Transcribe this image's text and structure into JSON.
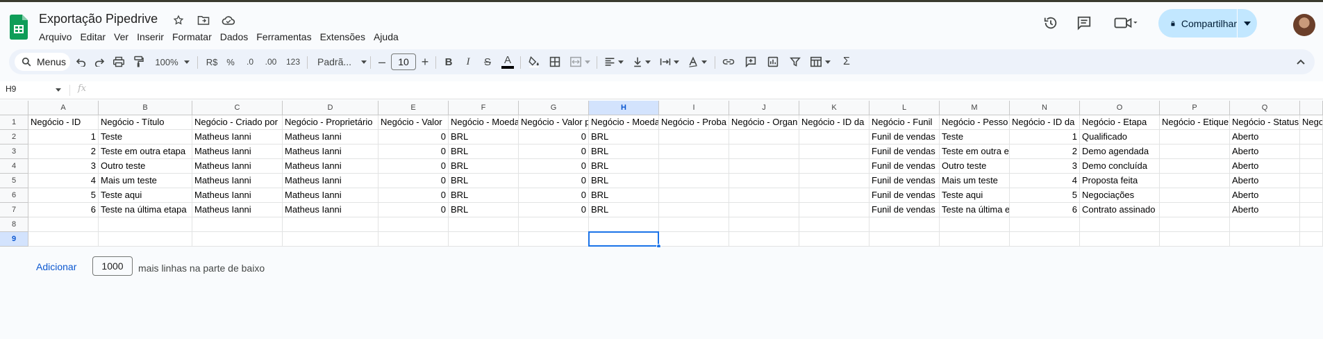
{
  "doc": {
    "title": "Exportação Pipedrive"
  },
  "menu": [
    "Arquivo",
    "Editar",
    "Ver",
    "Inserir",
    "Formatar",
    "Dados",
    "Ferramentas",
    "Extensões",
    "Ajuda"
  ],
  "share": {
    "label": "Compartilhar"
  },
  "toolbar": {
    "search_label": "Menus",
    "zoom": "100%",
    "currency": "R$",
    "percent": "%",
    "dec_less": ".0",
    "dec_more": ".00",
    "number_format": "123",
    "font": "Padrã...",
    "font_size": "10",
    "bold": "B",
    "italic": "I",
    "strike": "S",
    "text_color": "A",
    "sigma": "Σ"
  },
  "formula": {
    "namebox": "H9",
    "fx": "fx"
  },
  "grid": {
    "columns": [
      "A",
      "B",
      "C",
      "D",
      "E",
      "F",
      "G",
      "H",
      "I",
      "J",
      "K",
      "L",
      "M",
      "N",
      "O",
      "P",
      "Q"
    ],
    "rows": [
      "1",
      "2",
      "3",
      "4",
      "5",
      "6",
      "7",
      "8",
      "9"
    ],
    "selected_cell": "H9",
    "header_row": [
      "Negócio - ID",
      "Negócio - Título",
      "Negócio - Criado por",
      "Negócio - Proprietário",
      "Negócio - Valor",
      "Negócio - Moeda",
      "Negócio - Valor p",
      "Negócio - Moeda",
      "Negócio - Proba",
      "Negócio - Organ",
      "Negócio - ID da",
      "Negócio - Funil",
      "Negócio - Pesso",
      "Negócio - ID da",
      "Negócio - Etapa",
      "Negócio - Etique",
      "Negócio - Status",
      "Nego"
    ],
    "data": [
      [
        "1",
        "Teste",
        "Matheus Ianni",
        "Matheus Ianni",
        "0",
        "BRL",
        "0",
        "BRL",
        "",
        "",
        "",
        "Funil de vendas",
        "Teste",
        "1",
        "Qualificado",
        "",
        "Aberto"
      ],
      [
        "2",
        "Teste em outra etapa",
        "Matheus Ianni",
        "Matheus Ianni",
        "0",
        "BRL",
        "0",
        "BRL",
        "",
        "",
        "",
        "Funil de vendas",
        "Teste em outra e",
        "2",
        "Demo agendada",
        "",
        "Aberto"
      ],
      [
        "3",
        "Outro teste",
        "Matheus Ianni",
        "Matheus Ianni",
        "0",
        "BRL",
        "0",
        "BRL",
        "",
        "",
        "",
        "Funil de vendas",
        "Outro teste",
        "3",
        "Demo concluída",
        "",
        "Aberto"
      ],
      [
        "4",
        "Mais um teste",
        "Matheus Ianni",
        "Matheus Ianni",
        "0",
        "BRL",
        "0",
        "BRL",
        "",
        "",
        "",
        "Funil de vendas",
        "Mais um teste",
        "4",
        "Proposta feita",
        "",
        "Aberto"
      ],
      [
        "5",
        "Teste aqui",
        "Matheus Ianni",
        "Matheus Ianni",
        "0",
        "BRL",
        "0",
        "BRL",
        "",
        "",
        "",
        "Funil de vendas",
        "Teste aqui",
        "5",
        "Negociações",
        "",
        "Aberto"
      ],
      [
        "6",
        "Teste na última etapa",
        "Matheus Ianni",
        "Matheus Ianni",
        "0",
        "BRL",
        "0",
        "BRL",
        "",
        "",
        "",
        "Funil de vendas",
        "Teste na última e",
        "6",
        "Contrato assinado",
        "",
        "Aberto"
      ]
    ]
  },
  "add_rows": {
    "button": "Adicionar",
    "count": "1000",
    "suffix": "mais linhas na parte de baixo"
  }
}
